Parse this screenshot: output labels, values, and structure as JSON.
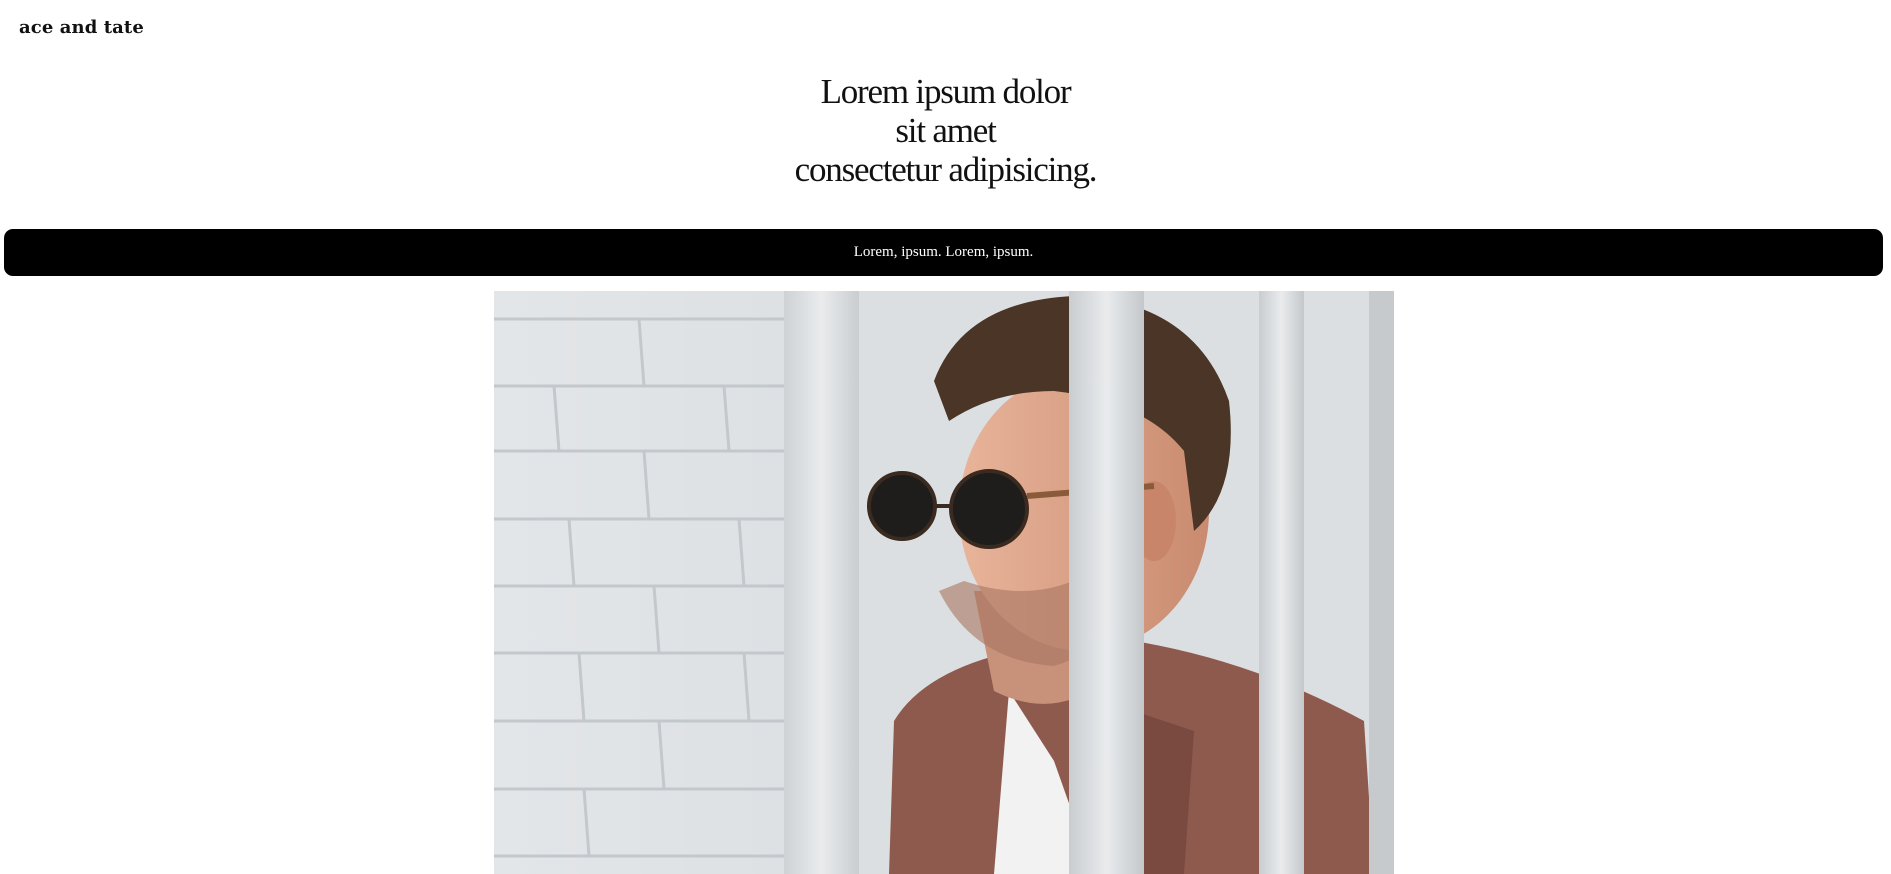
{
  "header": {
    "logo": "ace and tate"
  },
  "hero": {
    "headline_lines": [
      "Lorem ipsum dolor",
      "sit amet",
      "consectetur adipisicing."
    ]
  },
  "banner": {
    "text": "Lorem, ipsum. Lorem, ipsum."
  },
  "image": {
    "subject": "man-with-round-sunglasses-photo"
  },
  "colors": {
    "banner_bg": "#000000",
    "banner_text": "#ffffff",
    "text": "#111111",
    "background": "#ffffff"
  }
}
